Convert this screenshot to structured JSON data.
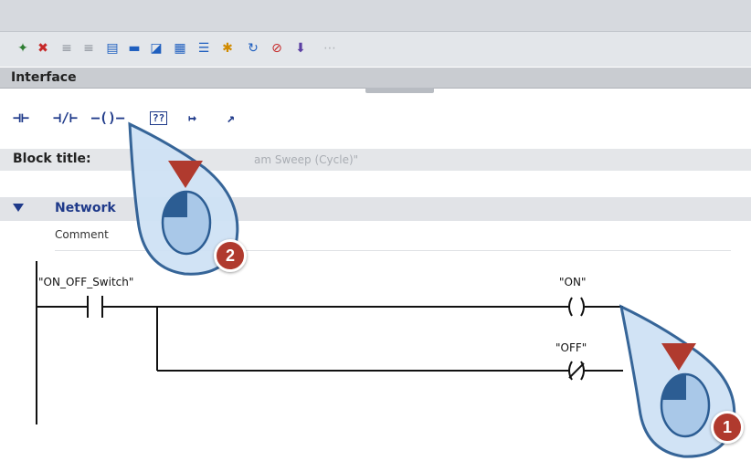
{
  "toolbar": {
    "icons": [
      "network-insert-icon",
      "network-delete-icon",
      "indent-icon",
      "outdent-icon",
      "block-view-icon",
      "block-view-2-icon",
      "comment-icon",
      "load-icon",
      "list-icon",
      "favorite-icon",
      "reset-icon",
      "error-icon",
      "download-icon",
      "more-icon"
    ]
  },
  "interface": {
    "label": "Interface"
  },
  "ladder": {
    "no_contact": "⊣⊢",
    "nc_contact": "⊣/⊢",
    "coil": "–()–",
    "empty_box": "??",
    "branch_open": "↦",
    "branch_close": "↗"
  },
  "block": {
    "title_label": "Block title:",
    "title_value": "am Sweep (Cycle)\""
  },
  "network": {
    "label": "Network",
    "comment_label": "Comment"
  },
  "diagram": {
    "contact_tag": "\"ON_OFF_Switch\"",
    "coil_on_tag": "\"ON\"",
    "coil_off_tag": "\"OFF\""
  },
  "callouts": {
    "step1": "1",
    "step2": "2"
  },
  "colors": {
    "accent": "#1f3a8a",
    "badge": "#b03a2e",
    "callout_fill": "#a9c8e8"
  }
}
